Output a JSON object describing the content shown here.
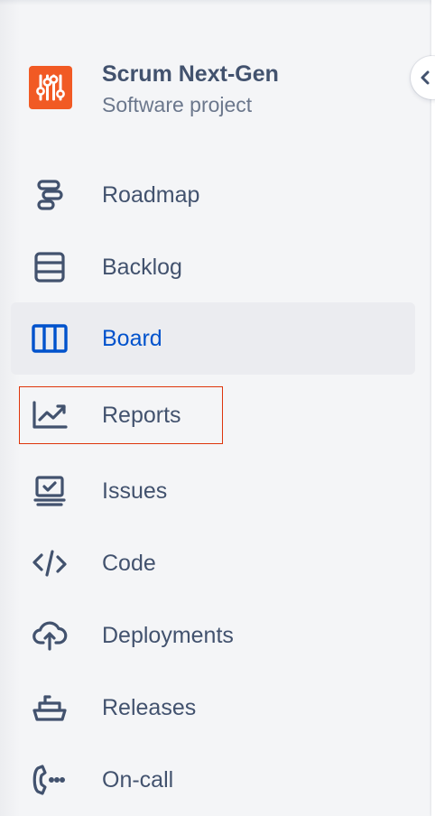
{
  "project": {
    "name": "Scrum Next-Gen",
    "type": "Software project",
    "avatar_icon": "sliders-icon",
    "avatar_color": "#f15a24"
  },
  "collapse_button": {
    "icon": "chevron-left-icon"
  },
  "nav": {
    "items": [
      {
        "label": "Roadmap",
        "icon": "roadmap-icon",
        "selected": false
      },
      {
        "label": "Backlog",
        "icon": "backlog-icon",
        "selected": false
      },
      {
        "label": "Board",
        "icon": "board-icon",
        "selected": true
      },
      {
        "label": "Reports",
        "icon": "reports-icon",
        "selected": false,
        "highlighted": true
      },
      {
        "label": "Issues",
        "icon": "issues-icon",
        "selected": false
      },
      {
        "label": "Code",
        "icon": "code-icon",
        "selected": false
      },
      {
        "label": "Deployments",
        "icon": "deployments-icon",
        "selected": false
      },
      {
        "label": "Releases",
        "icon": "releases-icon",
        "selected": false
      },
      {
        "label": "On-call",
        "icon": "on-call-icon",
        "selected": false
      }
    ]
  },
  "colors": {
    "text": "#42526e",
    "selected_text": "#0052cc",
    "selected_background": "#ebecf0",
    "highlight_border": "#de350b"
  }
}
